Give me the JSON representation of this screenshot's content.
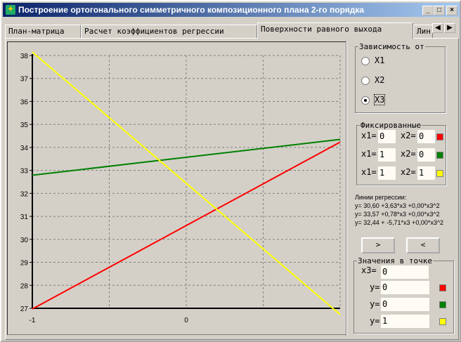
{
  "window": {
    "title": "Построение ортогонального симметричного композиционного плана 2-го порядка",
    "min": "_",
    "max": "□",
    "close": "×"
  },
  "tabs": [
    {
      "label": "План-матрица"
    },
    {
      "label": "Расчет коэффициентов регрессии"
    },
    {
      "label": "Поверхности равного выхода"
    },
    {
      "label": "Лин"
    }
  ],
  "tab_scroll": {
    "left": "◀",
    "right": "▶"
  },
  "dependency": {
    "title": "Зависимость от",
    "options": [
      {
        "label": "X1",
        "checked": false
      },
      {
        "label": "X2",
        "checked": false
      },
      {
        "label": "X3",
        "checked": true
      }
    ]
  },
  "fixed": {
    "title": "Фиксированные",
    "rows": [
      {
        "x1_label": "x1=",
        "x1": "0",
        "x2_label": "x2=",
        "x2": "0",
        "color": "#ff0000"
      },
      {
        "x1_label": "x1=",
        "x1": "1",
        "x2_label": "x2=",
        "x2": "0",
        "color": "#008000"
      },
      {
        "x1_label": "x1=",
        "x1": "1",
        "x2_label": "x2=",
        "x2": "1",
        "color": "#ffff00"
      }
    ]
  },
  "regression": {
    "title": "Линии регрессии:",
    "lines": [
      "y= 30,60 +3,63*x3 +0,00*x3^2",
      "y= 33,57 +0,78*x3 +0,00*x3^2",
      "y= 32,44 + -5,71*x3 +0,00*x3^2"
    ]
  },
  "nav": {
    "next": ">",
    "prev": "<"
  },
  "point": {
    "title": "Значения в точке",
    "x3_label": "x3=",
    "x3": "0",
    "rows": [
      {
        "label": "y=",
        "value": "0",
        "color": "#ff0000"
      },
      {
        "label": "y=",
        "value": "0",
        "color": "#008000"
      },
      {
        "label": "y=",
        "value": "1",
        "color": "#ffff00"
      }
    ]
  },
  "chart_data": {
    "type": "line",
    "xlim": [
      -1,
      1
    ],
    "ylim": [
      27,
      38
    ],
    "xticks": [
      "-1",
      "0"
    ],
    "yticks": [
      "27",
      "28",
      "29",
      "30",
      "31",
      "32",
      "33",
      "34",
      "35",
      "36",
      "37",
      "38"
    ],
    "grid": true,
    "series": [
      {
        "name": "red",
        "color": "#ff0000",
        "x": [
          -1,
          1
        ],
        "y": [
          26.97,
          34.23
        ]
      },
      {
        "name": "green",
        "color": "#008000",
        "x": [
          -1,
          1
        ],
        "y": [
          32.79,
          34.35
        ]
      },
      {
        "name": "yellow",
        "color": "#ffff00",
        "x": [
          -1,
          1
        ],
        "y": [
          38.15,
          26.73
        ]
      }
    ]
  }
}
